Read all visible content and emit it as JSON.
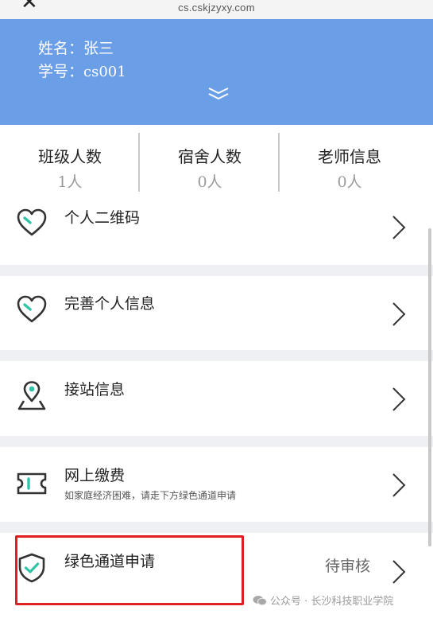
{
  "browser": {
    "url": "cs.cskjzyxy.com",
    "close_label": "✕"
  },
  "profile": {
    "name_label": "姓名：",
    "name_value": "张三",
    "id_label": "学号：",
    "id_value": "cs001"
  },
  "stats": [
    {
      "title": "班级人数",
      "value": "1人"
    },
    {
      "title": "宿舍人数",
      "value": "0人"
    },
    {
      "title": "老师信息",
      "value": "0人"
    }
  ],
  "menu": [
    {
      "title": "个人二维码",
      "icon": "heart-icon"
    },
    {
      "title": "完善个人信息",
      "icon": "heart-icon"
    },
    {
      "title": "接站信息",
      "icon": "location-pin-icon"
    },
    {
      "title": "网上缴费",
      "subtitle": "如家庭经济困难，请走下方绿色通道申请",
      "icon": "ticket-icon"
    },
    {
      "title": "绿色通道申请",
      "status": "待审核",
      "icon": "shield-check-icon"
    }
  ],
  "watermark": {
    "text": "公众号 · 长沙科技职业学院"
  },
  "colors": {
    "header_bg": "#6a9ee6",
    "accent_green": "#2ec4a6",
    "highlight_red": "#e02020"
  }
}
